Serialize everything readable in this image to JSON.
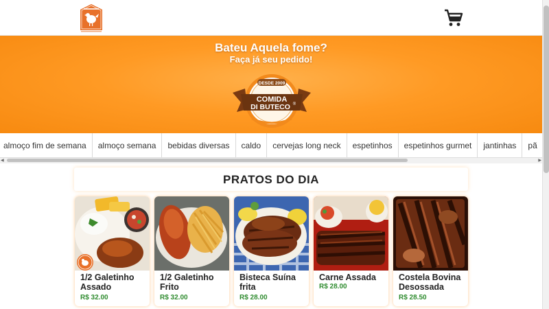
{
  "header": {
    "logo_icon": "chicken-logo-icon",
    "cart_icon": "shopping-cart-icon"
  },
  "hero": {
    "headline": "Bateu Aquela fome?",
    "subheadline": "Faça já seu pedido!",
    "badge": {
      "top_text": "DESDE 2009",
      "line1": "COMIDA",
      "line2": "DI BUTECO",
      "mark": "®"
    },
    "colors": {
      "primary": "#ff9a24",
      "dark": "#f78a10"
    }
  },
  "categories": [
    "almoço fim de semana",
    "almoço semana",
    "bebidas diversas",
    "caldo",
    "cervejas long neck",
    "espetinhos",
    "espetinhos gurmet",
    "jantinhas",
    "pã"
  ],
  "section": {
    "title": "PRATOS DO DIA"
  },
  "products": [
    {
      "name": "1/2 Galetinho Assado",
      "price": "R$ 32.00"
    },
    {
      "name": "1/2 Galetinho Frito",
      "price": "R$ 32.00"
    },
    {
      "name": "Bisteca Suína frita",
      "price": "R$ 28.00"
    },
    {
      "name": "Carne Assada",
      "price": "R$ 28.00"
    },
    {
      "name": "Costela Bovina Desossada",
      "price": "R$ 28.50"
    }
  ],
  "price_color": "#2e8b2e"
}
